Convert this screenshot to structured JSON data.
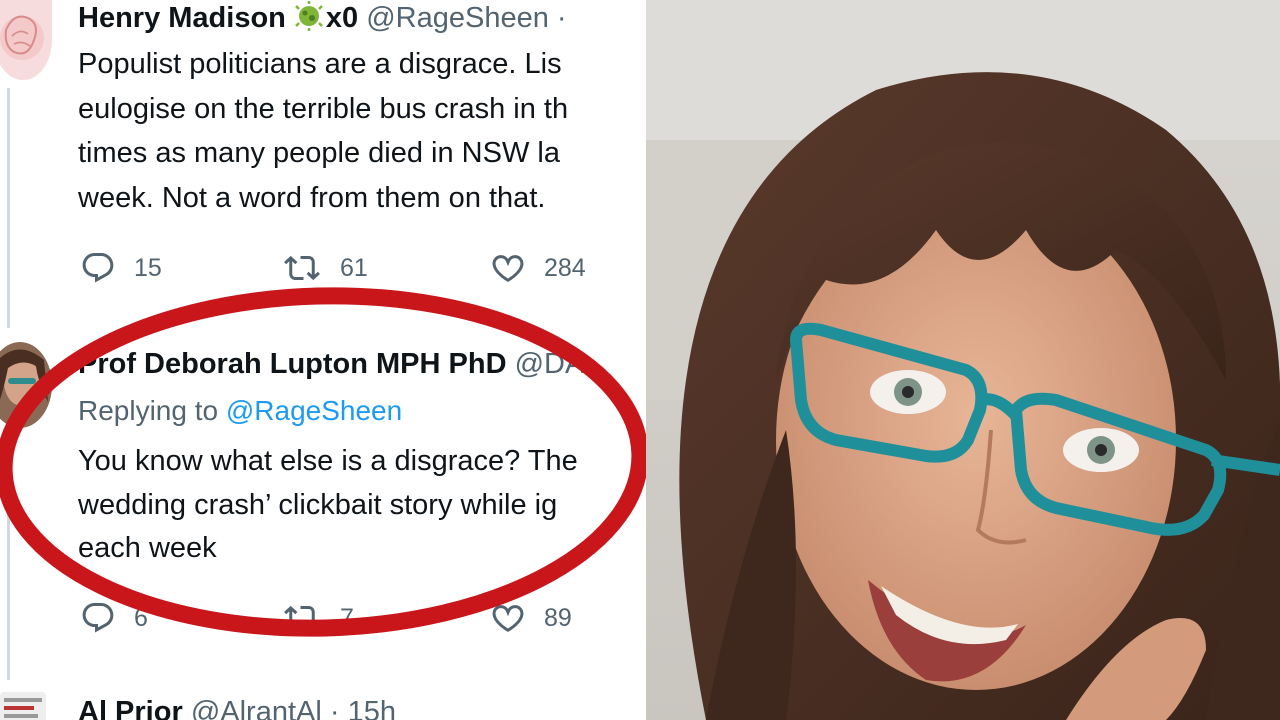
{
  "tweets": [
    {
      "name": "Henry Madison",
      "badge": "🦠x0",
      "handle": "@RageSheen ·",
      "lines": [
        "Populist politicians are a disgrace. Lis",
        "eulogise on the terrible bus crash in th",
        "times as many people died in NSW la",
        "week. Not a word from them on that."
      ],
      "replies": "15",
      "retweets": "61",
      "likes": "284"
    },
    {
      "name": "Prof Deborah Lupton MPH PhD",
      "handle": "@DA",
      "replying_prefix": "Replying to",
      "replying_to": "@RageSheen",
      "lines": [
        "You know what else is a disgrace? The",
        "wedding crash’ clickbait story while ig",
        "each week"
      ],
      "replies": "6",
      "retweets": "7",
      "likes": "89"
    },
    {
      "name": "Al Prior",
      "handle": "@AlrantAl · 15h"
    }
  ],
  "colors": {
    "text": "#0f1419",
    "secondary": "#536471",
    "link": "#1d9bf0",
    "highlight_circle": "#c8161b"
  },
  "icons": [
    "reply-icon",
    "retweet-icon",
    "like-icon",
    "microbe-emoji"
  ]
}
